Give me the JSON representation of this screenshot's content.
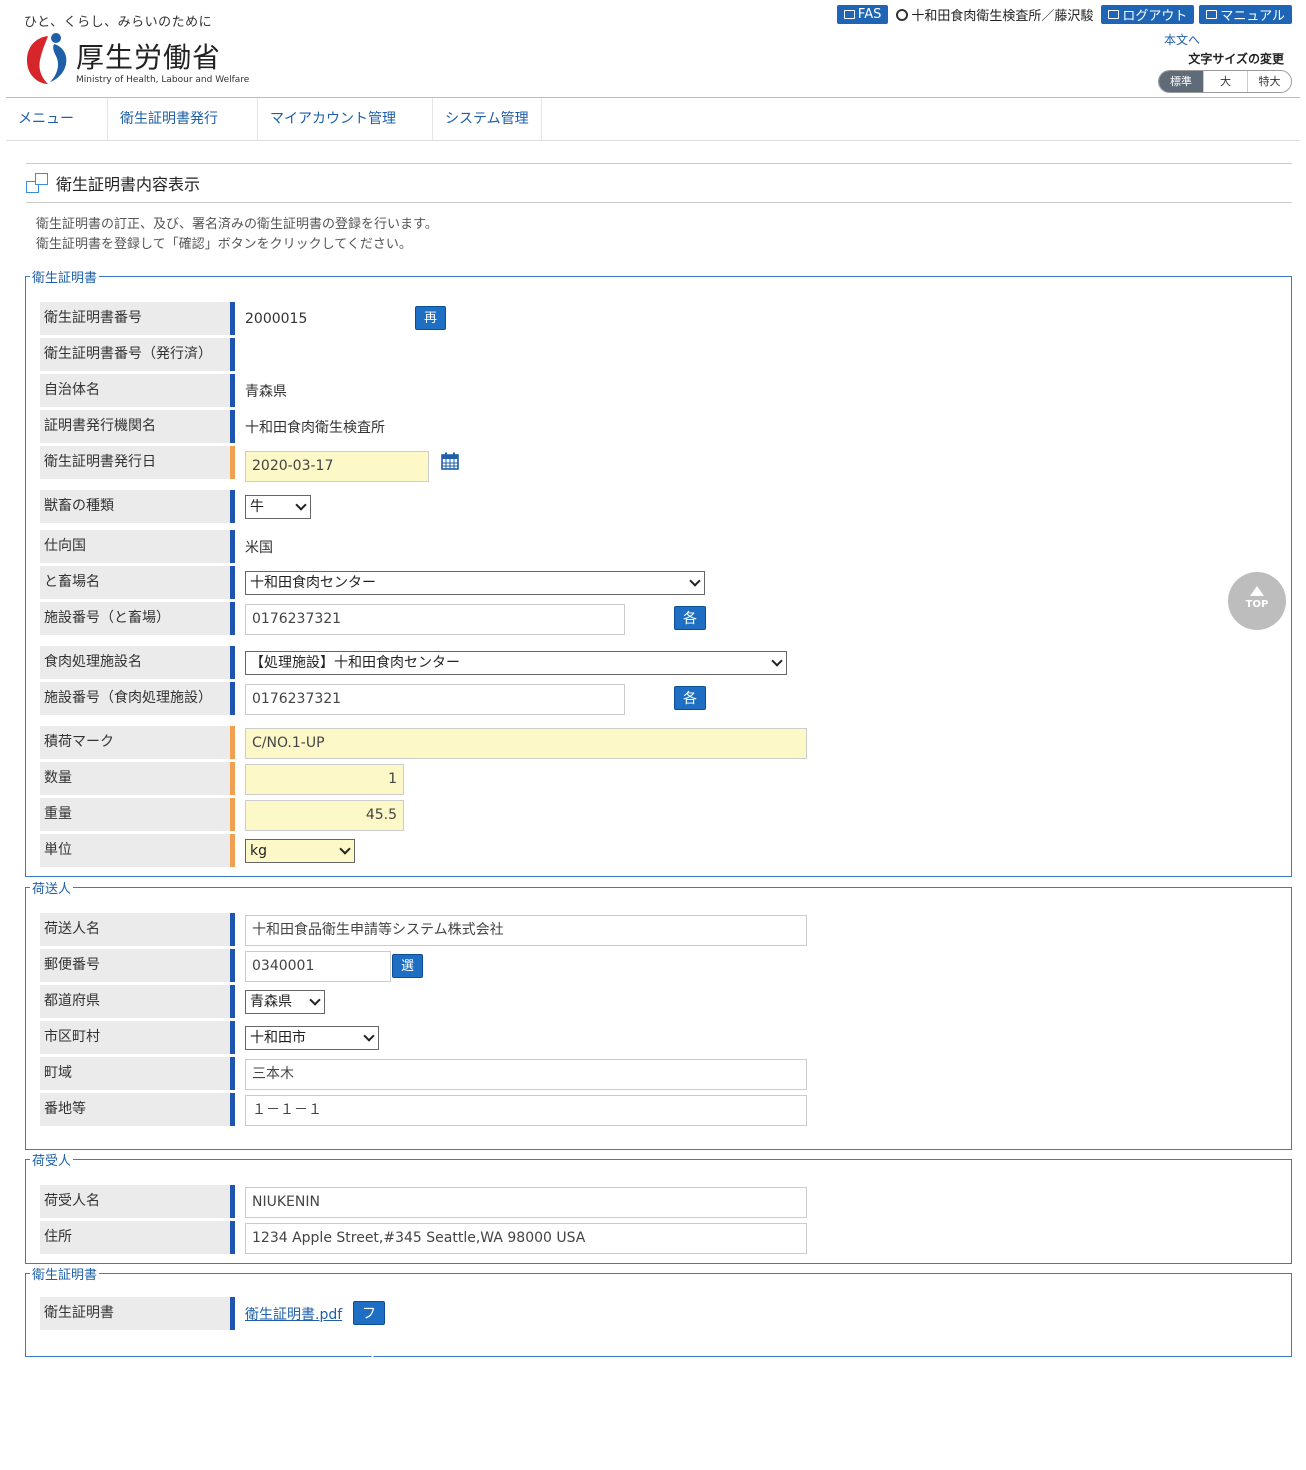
{
  "header": {
    "tagline": "ひと、くらし、みらいのために",
    "logo_jp": "厚生労働省",
    "logo_en": "Ministry of Health, Labour and Welfare",
    "fas_label": "FAS",
    "user_label": "十和田食肉衛生検査所／藤沢駿",
    "logout_label": "ログアウト",
    "manual_label": "マニュアル",
    "skip_label": "本文へ",
    "font_size_label": "文字サイズの変更",
    "font_sizes": [
      "標準",
      "大",
      "特大"
    ]
  },
  "nav": [
    "メニュー",
    "衛生証明書発行",
    "マイアカウント管理",
    "システム管理"
  ],
  "page": {
    "title": "衛生証明書内容表示",
    "desc1": "衛生証明書の訂正、及び、署名済みの衛生証明書の登録を行います。",
    "desc2": "衛生証明書を登録して「確認」ボタンをクリックしてください。"
  },
  "cert": {
    "legend": "衛生証明書",
    "number_label": "衛生証明書番号",
    "number": "2000015",
    "reissue_btn": "再発行",
    "issued_number_label": "衛生証明書番号（発行済）",
    "municipality_label": "自治体名",
    "municipality": "青森県",
    "issuer_label": "証明書発行機関名",
    "issuer": "十和田食肉衛生検査所",
    "issue_date_label": "衛生証明書発行日",
    "issue_date": "2020-03-17",
    "animal_label": "獣畜の種類",
    "animal": "牛",
    "dest_label": "仕向国",
    "dest": "米国",
    "slaughter_label": "と畜場名",
    "slaughter": "十和田食肉センター",
    "slaughter_no_label": "施設番号（と畜場）",
    "slaughter_no": "0176237321",
    "reports_btn": "各種報告書一覧",
    "processing_label": "食肉処理施設名",
    "processing": "【処理施設】十和田食肉センター",
    "processing_no_label": "施設番号（食肉処理施設）",
    "processing_no": "0176237321",
    "mark_label": "積荷マーク",
    "mark": "C/NO.1-UP",
    "qty_label": "数量",
    "qty": "1",
    "weight_label": "重量",
    "weight": "45.5",
    "unit_label": "単位",
    "unit": "kg"
  },
  "shipper": {
    "legend": "荷送人",
    "name_label": "荷送人名",
    "name": "十和田食品衛生申請等システム株式会社",
    "zip_label": "郵便番号",
    "zip": "0340001",
    "select_btn": "選択",
    "pref_label": "都道府県",
    "pref": "青森県",
    "city_label": "市区町村",
    "city": "十和田市",
    "town_label": "町域",
    "town": "三本木",
    "addr_label": "番地等",
    "addr": "１－１－１"
  },
  "consignee": {
    "legend": "荷受人",
    "name_label": "荷受人名",
    "name": "NIUKENIN",
    "addr_label": "住所",
    "addr": "1234 Apple Street,#345 Seattle,WA 98000 USA"
  },
  "file": {
    "legend": "衛生証明書",
    "label": "衛生証明書",
    "filename": "衛生証明書.pdf",
    "clear_btn": "ファイルクリア"
  },
  "totop": "TOP",
  "colors": {
    "accent": "#1e6fc4",
    "required": "#f0a050",
    "border": "#3a7bc8",
    "input_yellow": "#fdf8c8"
  }
}
